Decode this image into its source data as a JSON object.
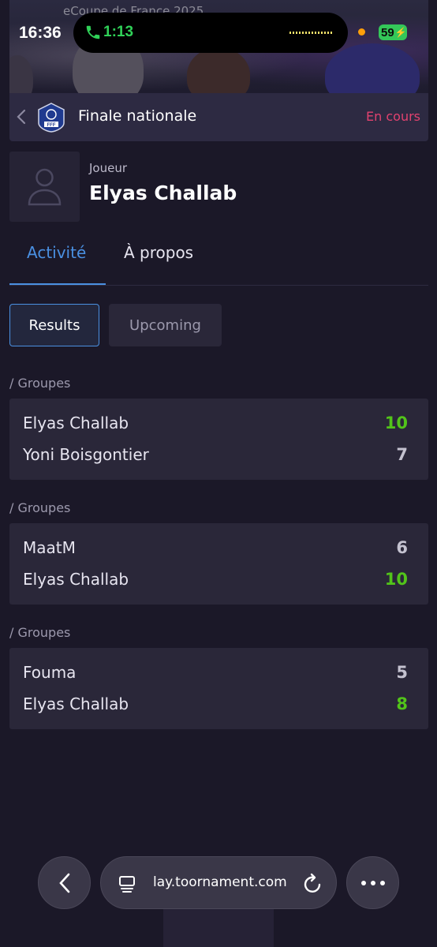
{
  "status_bar": {
    "time": "16:36",
    "call_time": "1:13",
    "battery": "59"
  },
  "hero": {
    "caption": "eCoupe de France 2025"
  },
  "tournament": {
    "name": "Finale nationale",
    "status": "En cours",
    "logo_text": "FFF",
    "status_color": "#e2426f"
  },
  "player": {
    "role": "Joueur",
    "name": "Elyas Challab"
  },
  "tabs": [
    {
      "label": "Activité",
      "active": true
    },
    {
      "label": "À propos",
      "active": false
    }
  ],
  "filters": [
    {
      "label": "Results",
      "active": true
    },
    {
      "label": "Upcoming",
      "active": false
    }
  ],
  "matches": [
    {
      "group": "/ Groupes",
      "players": [
        {
          "name": "Elyas Challab",
          "score": "10",
          "winner": true
        },
        {
          "name": "Yoni Boisgontier",
          "score": "7",
          "winner": false
        }
      ]
    },
    {
      "group": "/ Groupes",
      "players": [
        {
          "name": "MaatM",
          "score": "6",
          "winner": false
        },
        {
          "name": "Elyas Challab",
          "score": "10",
          "winner": true
        }
      ]
    },
    {
      "group": "/ Groupes",
      "players": [
        {
          "name": "Fouma",
          "score": "5",
          "winner": false
        },
        {
          "name": "Elyas Challab",
          "score": "8",
          "winner": true
        }
      ]
    }
  ],
  "browser": {
    "url": "lay.toornament.com"
  },
  "colors": {
    "accent": "#4a90e2",
    "win": "#52c41a",
    "background": "#1b1828",
    "card": "#2a2739"
  }
}
